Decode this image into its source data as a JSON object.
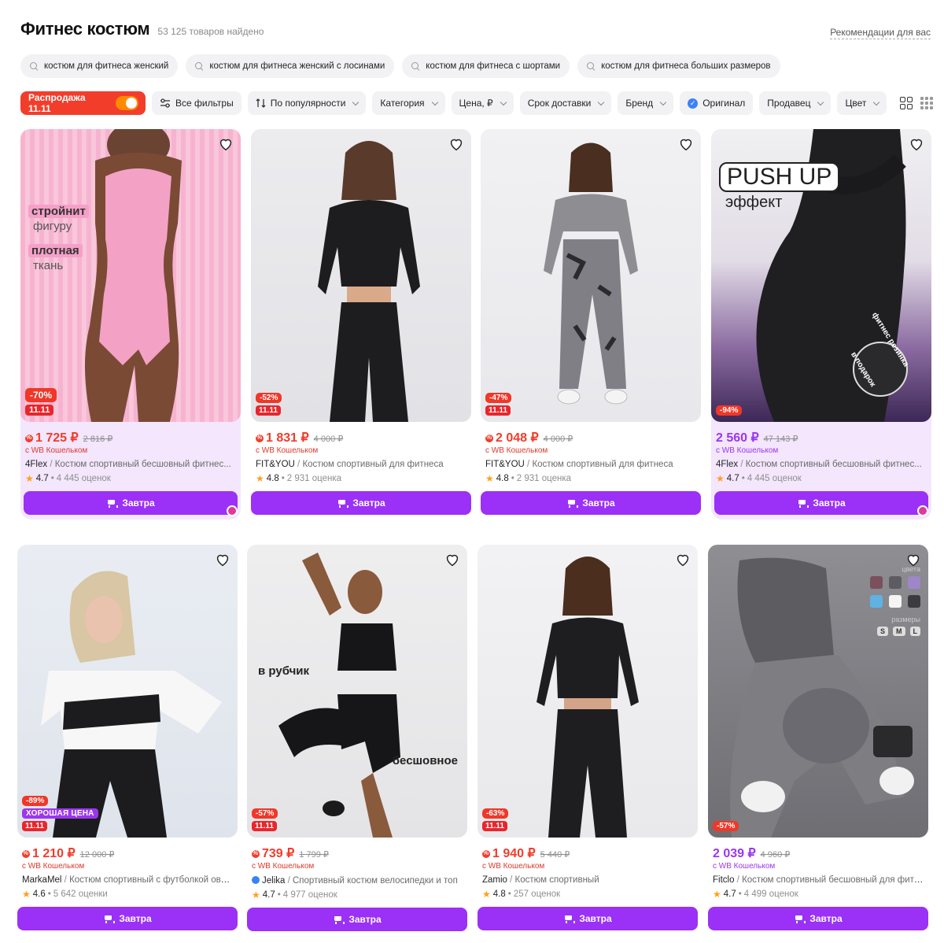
{
  "header": {
    "title": "Фитнес костюм",
    "count": "53 125 товаров найдено",
    "reco_link": "Рекомендации для вас"
  },
  "suggestions": [
    "костюм для фитнеса женский",
    "костюм для фитнеса женский с лосинами",
    "костюм для фитнеса с шортами",
    "костюм для фитнеса больших размеров"
  ],
  "filters": {
    "sale": "Распродажа 11.11",
    "all_filters": "Все фильтры",
    "sort": "По популярности",
    "category": "Категория",
    "price": "Цена, ₽",
    "delivery": "Срок доставки",
    "brand": "Бренд",
    "original": "Оригинал",
    "seller": "Продавец",
    "color": "Цвет"
  },
  "buy_label": "Завтра",
  "products": [
    {
      "price": "1 725 ₽",
      "old_price": "2 816 ₽",
      "wallet": "с WB Кошельком",
      "brand": "4Flex",
      "name": "Костюм спортивный бесшовный фитнес...",
      "rating": "4.7",
      "reviews": "4 445 оценок",
      "discount": "-70%",
      "event": "11.11",
      "overlay": [
        "стройнит",
        "фигуру",
        "плотная",
        "ткань"
      ]
    },
    {
      "price": "1 831 ₽",
      "old_price": "4 000 ₽",
      "wallet": "с WB Кошельком",
      "brand": "FIT&YOU",
      "name": "Костюм спортивный для фитнеса",
      "rating": "4.8",
      "reviews": "2 931 оценка",
      "discount": "-52%",
      "event": "11.11"
    },
    {
      "price": "2 048 ₽",
      "old_price": "4 000 ₽",
      "wallet": "с WB Кошельком",
      "brand": "FIT&YOU",
      "name": "Костюм спортивный для фитнеса",
      "rating": "4.8",
      "reviews": "2 931 оценка",
      "discount": "-47%",
      "event": "11.11"
    },
    {
      "price": "2 560 ₽",
      "old_price": "47 143 ₽",
      "wallet": "с WB Кошельком",
      "brand": "4Flex",
      "name": "Костюм спортивный бесшовный фитнес...",
      "rating": "4.7",
      "reviews": "4 445 оценок",
      "discount": "-94%",
      "overlay": [
        "PUSH UP",
        "эффект",
        "фитнес резинка",
        "в подарок"
      ]
    },
    {
      "price": "1 210 ₽",
      "old_price": "12 000 ₽",
      "wallet": "с WB Кошельком",
      "brand": "MarkaMel",
      "name": "Костюм спортивный с футболкой овер...",
      "rating": "4.6",
      "reviews": "5 642 оценки",
      "discount": "-89%",
      "good_price": "ХОРОШАЯ ЦЕНА",
      "event": "11.11"
    },
    {
      "price": "739 ₽",
      "old_price": "1 799 ₽",
      "wallet": "с WB Кошельком",
      "brand": "Jelika",
      "name": "Спортивный костюм велосипедки и топ",
      "rating": "4.7",
      "reviews": "4 977 оценок",
      "discount": "-57%",
      "event": "11.11",
      "overlay": [
        "в рубчик",
        "бесшовное"
      ]
    },
    {
      "price": "1 940 ₽",
      "old_price": "5 440 ₽",
      "wallet": "с WB Кошельком",
      "brand": "Zamio",
      "name": "Костюм спортивный",
      "rating": "4.8",
      "reviews": "257 оценок",
      "discount": "-63%",
      "event": "11.11"
    },
    {
      "price": "2 039 ₽",
      "old_price": "4 960 ₽",
      "wallet": "с WB Кошельком",
      "brand": "Fitclo",
      "name": "Костюм спортивный бесшовный для фитн...",
      "rating": "4.7",
      "reviews": "4 499 оценок",
      "discount": "-57%",
      "overlay": [
        "цвета",
        "размеры",
        "S",
        "M",
        "L"
      ]
    }
  ],
  "colors": {
    "accent_purple": "#9b30f6",
    "sale_red": "#f33d2b",
    "price_red": "#f13c2b",
    "sponsored_bg": "#f3e6fd"
  }
}
